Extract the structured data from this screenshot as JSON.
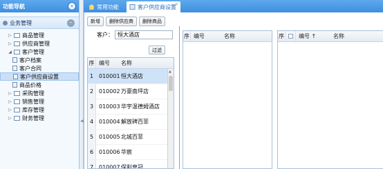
{
  "sidebar": {
    "title": "功能导航",
    "section": "业务管理",
    "items": [
      {
        "label": "商品管理",
        "expanded": false
      },
      {
        "label": "供应商管理",
        "expanded": false
      },
      {
        "label": "客户管理",
        "expanded": true,
        "children": [
          "客户档案",
          "客户合同",
          "客户供应商设置",
          "商品价格"
        ],
        "selected_child": "客户供应商设置"
      },
      {
        "label": "采购管理",
        "expanded": false
      },
      {
        "label": "销售管理",
        "expanded": false
      },
      {
        "label": "库存管理",
        "expanded": false
      },
      {
        "label": "财务管理",
        "expanded": false
      }
    ]
  },
  "tabs": [
    {
      "label": "常用功能",
      "active": false
    },
    {
      "label": "客户供应商设置",
      "active": true
    }
  ],
  "toolbar": {
    "add": "新增",
    "delete_supplier": "删除供应商",
    "delete_product": "删除商品"
  },
  "customer": {
    "label": "客户：",
    "value": "恒大酒店",
    "filter": "过滤"
  },
  "grid1": {
    "columns": {
      "idx": "序",
      "code": "编号",
      "name": "名称"
    },
    "rows": [
      {
        "idx": "1",
        "code": "010001",
        "name": "恒大酒店",
        "selected": true
      },
      {
        "idx": "2",
        "code": "010002",
        "name": "万豪南坪店"
      },
      {
        "idx": "3",
        "code": "010003",
        "name": "华宇温德姆酒店"
      },
      {
        "idx": "4",
        "code": "010004",
        "name": "解放碑百菲"
      },
      {
        "idx": "5",
        "code": "010005",
        "name": "北城百菲"
      },
      {
        "idx": "6",
        "code": "010006",
        "name": "华宸"
      },
      {
        "idx": "7",
        "code": "010007",
        "name": "保利皇冠"
      }
    ]
  },
  "grid2": {
    "columns": {
      "idx": "序",
      "code": "编号",
      "name": "名称"
    }
  },
  "grid3": {
    "columns": {
      "idx": "序",
      "code": "编号 ↑",
      "name": "名称"
    }
  },
  "colors": {
    "header_blue": "#4a9be7",
    "selected_row": "#cfe3f8",
    "sidebar_bg": "#f4f9fe"
  }
}
